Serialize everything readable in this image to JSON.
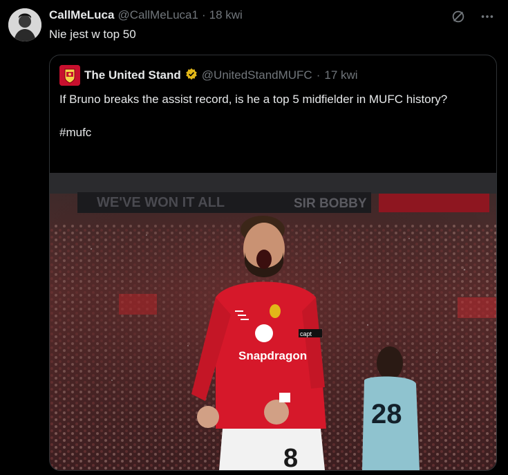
{
  "post": {
    "display_name": "CallMeLuca",
    "handle": "@CallMeLuca1",
    "separator": "·",
    "time": "18 kwi",
    "text": "Nie jest w top 50"
  },
  "quoted": {
    "display_name": "The United Stand",
    "handle": "@UnitedStandMUFC",
    "separator": "·",
    "time": "17 kwi",
    "text_line": "If Bruno breaks the assist record, is he a top 5 midfielder in MUFC history?",
    "hashtag": "#mufc",
    "verified_icon": "gold-verified-badge-icon"
  },
  "photo": {
    "banner_left": "WE'VE WON IT ALL",
    "banner_right": "SIR BOBBY",
    "sponsor": "Snapdragon",
    "captain_text": "capt",
    "shirt_number_main": "8",
    "shirt_number_other": "28"
  },
  "icons": {
    "grok": "grok-icon",
    "more": "more-icon"
  },
  "colors": {
    "background": "#000000",
    "text": "#e7e9ea",
    "muted": "#71767b",
    "border": "#2f3336",
    "verified": "#e2b719",
    "united_red": "#c8102e"
  }
}
